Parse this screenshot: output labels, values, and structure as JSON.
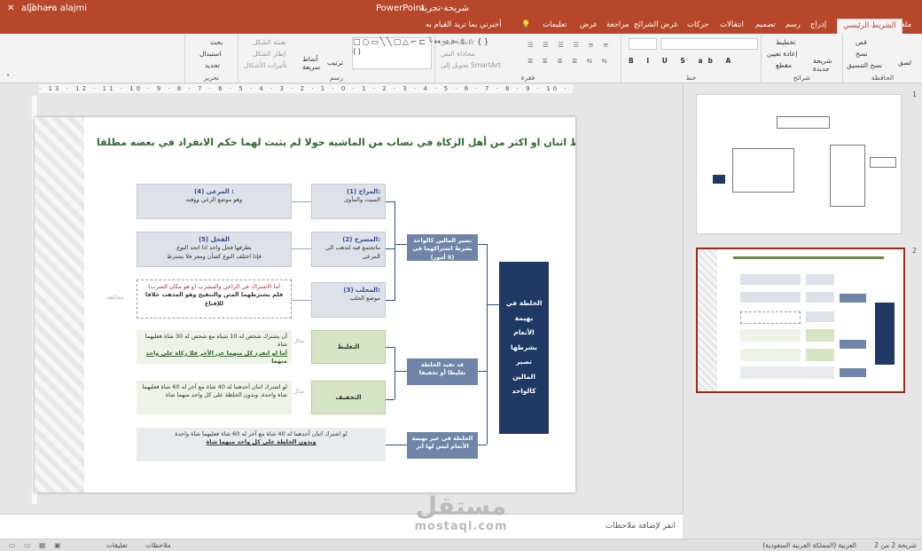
{
  "titlebar": {
    "app": "PowerPoint",
    "doc": "شريحة-تجربة",
    "user": "aljohara alajmi",
    "avatar": "AA",
    "minimize": "─",
    "maximize": "☐",
    "close": "✕"
  },
  "tabs": [
    "ملف",
    "الشريط الرئيسي",
    "إدراج",
    "رسم",
    "تصميم",
    "انتقالات",
    "حركات",
    "عرض الشرائح",
    "مراجعة",
    "عرض",
    "تعليمات",
    "أخبرني بما تريد القيام به"
  ],
  "ribbon": {
    "clipboard": {
      "paste": "لصق",
      "cut": "قص",
      "copy": "نسخ",
      "format_painter": "نسخ التنسيق",
      "label": "الحافظة"
    },
    "slides": {
      "new": "شريحة جديدة",
      "layout": "تخطيط",
      "reset": "إعادة تعيين",
      "section": "مقطع",
      "label": "شرائح"
    },
    "font": {
      "label": "خط"
    },
    "paragraph": {
      "label": "فقرة",
      "text_dir": "اتجاه النص",
      "align_text": "محاذاة النص",
      "smartart": "تحويل إلى SmartArt"
    },
    "drawing": {
      "arrange": "ترتيب",
      "quick_styles": "أنماط سريعة",
      "fill": "تعبئة الشكل",
      "outline": "إطار الشكل",
      "effects": "تأثيرات الأشكال",
      "label": "رسم"
    },
    "editing": {
      "find": "بحث",
      "replace": "استبدال",
      "select": "تحديد",
      "label": "تحرير"
    }
  },
  "ruler": "· 13 · 12 · 11 · 10 · 9 · 8 · 7 · 6 · 5 · 4 · 3 · 2 · 1 · 0 · 1 · 2 · 3 · 4 · 5 · 6 · 7 · 8 · 9 · 10 · 11 · 12 · 13 ·",
  "slide": {
    "title": "الخلطة : أن يختلط اثنان او اكثر من أهل الزكاة في نصاب من الماشية حولا لم يثبت لهما حكم الانفراد في بعضه مطلقا",
    "title_bullet": "❖",
    "main_box": "الخلطة في بهيمة الأنعام بشرطها تصير المالين كالواحد",
    "mid1": "تصير المالين كالواحد بشرط اشتراكهما في (5 أمور)",
    "mid2": "قد تفيد الخلطة تغليظا أو تخفيفا",
    "mid3": "الخلطة في غير بهيمة الأنعام ليس لها أثر",
    "c1_title": "(1) المراح:",
    "c1_body": "المبيت والمأوى",
    "c2_title": "(2) المسرح:",
    "c2_body": "ماتجتمع فيه لتذهب الى المرعى",
    "c3_title": "(3) المحلب:",
    "c3_body": "موضع الحلب",
    "d1_title": "(4) المرعى :",
    "d1_body": "وهو موضع الرعي ووقته",
    "d2_title": "(5) الفحل",
    "d2_body1": "بطرقها فحل واحد اذا اتحد النوع",
    "d2_body2": "فإذا اختلف النوع كضأن ومعز فلا يشترط",
    "d3_line1": "أما الاشتراك في الراعي والمشرب (و هو مكان الشرب)",
    "d3_line2": "فلم يشترطهما المتن والتنقيح وهو المذهب خلافا للإقناع",
    "tag_disagree": "مخالفة",
    "tag_ex1": "مثال",
    "tag_ex2": "مثال",
    "g1": "التغليظ",
    "g2": "التخفيف",
    "e1_line1": "أن يشترك شخص له 10 شياه مع شخص له 30 شاة فعليهما شاة",
    "e1_line2": "أما لو انفرد كل منهما عن الآخر فلا زكاة على واحد منهما",
    "e2_line1": "لو اشترك اثنان أحدهما له 40 شاة مع آخر له 60 شاة فعليهما",
    "e2_line2": "شاة واحدة، وبدون الخلطة على كل واحد منهما شاة",
    "e3_line1": "لو اشترك اثنان أحدهما له 40 شاة مع آخر له 60 شاة فعليهما شاة واحدة",
    "e3_line2": "وبدون الخلطة على كل واحد منهما شاة"
  },
  "thumbnails": [
    {
      "num": "1"
    },
    {
      "num": "2",
      "selected": true
    }
  ],
  "notes_placeholder": "انقر لإضافة ملاحظات",
  "watermark": {
    "ar": "مستقل",
    "en": "mostaql.com"
  },
  "status": {
    "slide": "شريحة 2 من 2",
    "language": "العربية (المملكة العربية السعودية)",
    "notes": "ملاحظات",
    "comments": "تعليقات"
  },
  "colors": {
    "accent": "#b7472a",
    "navy": "#1f3964",
    "green": "#2e6a2e"
  }
}
